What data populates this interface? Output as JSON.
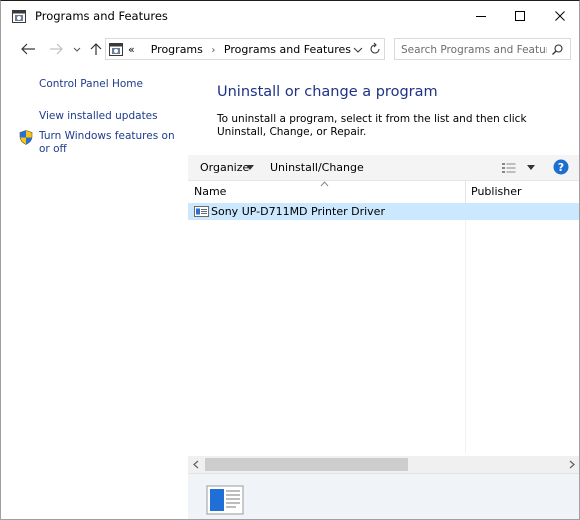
{
  "window": {
    "title": "Programs and Features",
    "controls": {
      "minimize": "minimize",
      "maximize": "maximize",
      "close": "close"
    }
  },
  "navigation": {
    "breadcrumb": {
      "overflow": "«",
      "items": [
        "Programs",
        "Programs and Features"
      ],
      "separator": "›"
    },
    "search": {
      "placeholder": "Search Programs and Features",
      "value": ""
    }
  },
  "sidebar": {
    "items": [
      {
        "label": "Control Panel Home"
      },
      {
        "label": "View installed updates"
      },
      {
        "label": "Turn Windows features on or off",
        "icon": "shield-icon"
      }
    ]
  },
  "main": {
    "heading": "Uninstall or change a program",
    "description": "To uninstall a program, select it from the list and then click Uninstall, Change, or Repair."
  },
  "toolbar": {
    "organize_label": "Organize",
    "uninstall_label": "Uninstall/Change",
    "view_icon": "details-view-icon",
    "help_icon": "help-icon"
  },
  "list": {
    "columns": [
      "Name",
      "Publisher"
    ],
    "sort_column": "Name",
    "rows": [
      {
        "name": "Sony UP-D711MD Printer Driver",
        "publisher": "",
        "selected": true
      }
    ]
  },
  "colors": {
    "link": "#1e3c8c",
    "heading": "#1e3287",
    "selection": "#cce8ff",
    "command_bar": "#f4f4f4",
    "details_pane": "#f0f4f9",
    "help": "#1a6fcf"
  }
}
